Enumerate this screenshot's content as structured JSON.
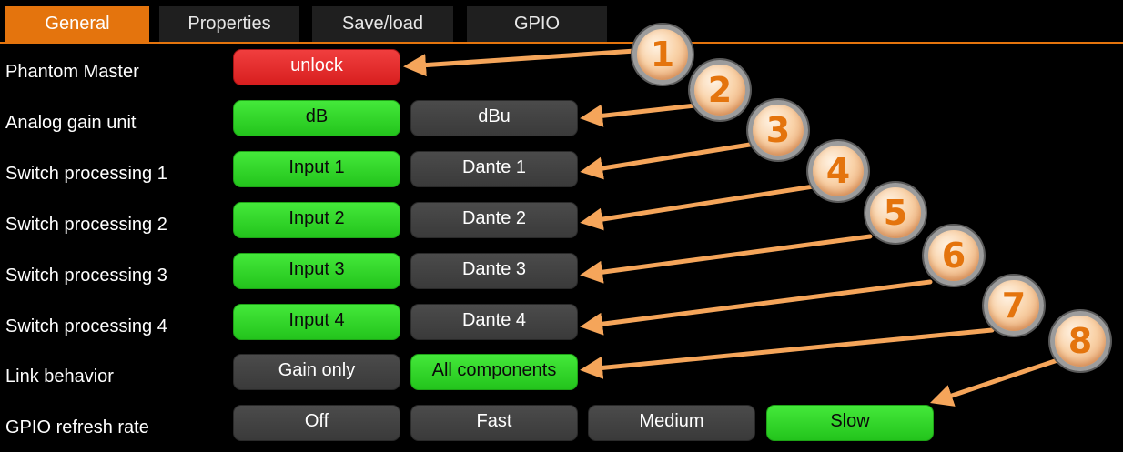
{
  "tabs": [
    {
      "label": "General",
      "active": true
    },
    {
      "label": "Properties",
      "active": false
    },
    {
      "label": "Save/load",
      "active": false
    },
    {
      "label": "GPIO",
      "active": false
    }
  ],
  "rows": [
    {
      "label": "Phantom Master",
      "options": [
        {
          "label": "unlock",
          "state": "red"
        }
      ]
    },
    {
      "label": "Analog gain unit",
      "options": [
        {
          "label": "dB",
          "state": "selected"
        },
        {
          "label": "dBu",
          "state": "off"
        }
      ]
    },
    {
      "label": "Switch processing 1",
      "options": [
        {
          "label": "Input 1",
          "state": "selected"
        },
        {
          "label": "Dante 1",
          "state": "off"
        }
      ]
    },
    {
      "label": "Switch processing 2",
      "options": [
        {
          "label": "Input 2",
          "state": "selected"
        },
        {
          "label": "Dante 2",
          "state": "off"
        }
      ]
    },
    {
      "label": "Switch processing 3",
      "options": [
        {
          "label": "Input 3",
          "state": "selected"
        },
        {
          "label": "Dante 3",
          "state": "off"
        }
      ]
    },
    {
      "label": "Switch processing 4",
      "options": [
        {
          "label": "Input 4",
          "state": "selected"
        },
        {
          "label": "Dante 4",
          "state": "off"
        }
      ]
    },
    {
      "label": "Link behavior",
      "options": [
        {
          "label": "Gain only",
          "state": "off"
        },
        {
          "label": "All components",
          "state": "selected"
        }
      ]
    },
    {
      "label": "GPIO refresh rate",
      "options": [
        {
          "label": "Off",
          "state": "off"
        },
        {
          "label": "Fast",
          "state": "off"
        },
        {
          "label": "Medium",
          "state": "off"
        },
        {
          "label": "Slow",
          "state": "selected"
        }
      ]
    }
  ],
  "callouts": [
    "1",
    "2",
    "3",
    "4",
    "5",
    "6",
    "7",
    "8"
  ],
  "colors": {
    "accent": "#e4740d",
    "selected": "#2fd626",
    "unlock": "#e52c2c",
    "off": "#404040",
    "arrow": "#f5a55a"
  }
}
